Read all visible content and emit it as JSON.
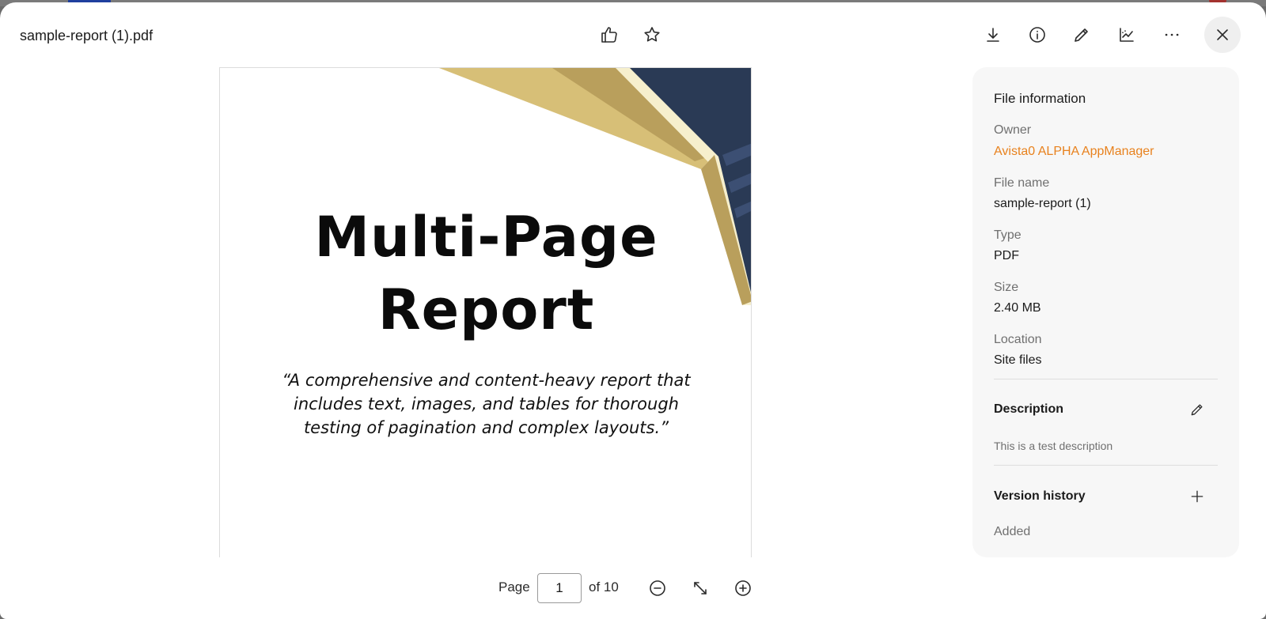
{
  "header": {
    "file_title": "sample-report (1).pdf"
  },
  "toolbar": {
    "center_icons": [
      "thumbs-up-icon",
      "star-icon"
    ],
    "right_icons": [
      "download-icon",
      "info-icon",
      "pencil-icon",
      "chart-icon",
      "more-icon",
      "close-icon"
    ]
  },
  "document": {
    "title_line1": "Multi-Page",
    "title_line2": "Report",
    "quote": "“A comprehensive and content-heavy report that includes text, images, and tables for thorough testing of pagination and complex layouts.”",
    "colors": {
      "navy": "#2a3a55",
      "gold": "#d7bf77",
      "gold_dark": "#b99f5c",
      "cream": "#f6efcd"
    }
  },
  "panel": {
    "heading": "File information",
    "owner_label": "Owner",
    "owner_value": "Avista0 ALPHA AppManager",
    "file_name_label": "File name",
    "file_name_value": "sample-report (1)",
    "type_label": "Type",
    "type_value": "PDF",
    "size_label": "Size",
    "size_value": "2.40 MB",
    "location_label": "Location",
    "location_value": "Site files",
    "description_title": "Description",
    "description_text": "This is a test description",
    "version_history_title": "Version history",
    "added_label": "Added",
    "accent_color": "#e8821e"
  },
  "footer": {
    "page_label": "Page",
    "page_value": "1",
    "of_label": "of 10"
  }
}
